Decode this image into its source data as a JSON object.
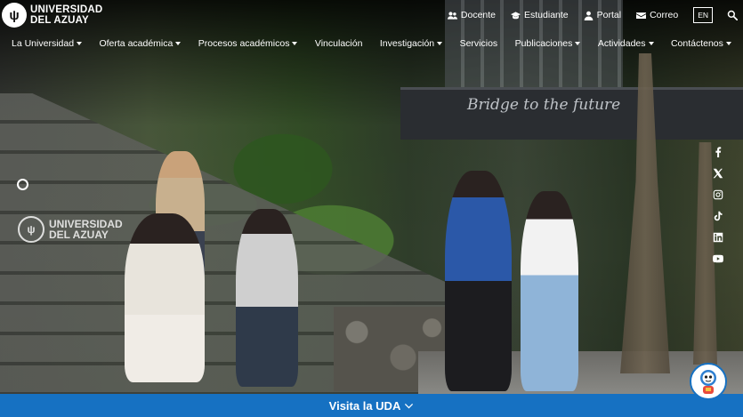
{
  "brand": {
    "line1": "UNIVERSIDAD",
    "line2": "DEL AZUAY"
  },
  "toplinks": [
    {
      "label": "Docente",
      "icon": "users-icon"
    },
    {
      "label": "Estudiante",
      "icon": "graduation-cap-icon"
    },
    {
      "label": "Portal",
      "icon": "user-icon"
    },
    {
      "label": "Correo",
      "icon": "envelope-icon"
    }
  ],
  "language": "EN",
  "nav": [
    {
      "label": "La Universidad",
      "dropdown": true
    },
    {
      "label": "Oferta académica",
      "dropdown": true
    },
    {
      "label": "Procesos académicos",
      "dropdown": true
    },
    {
      "label": "Vinculación",
      "dropdown": false
    },
    {
      "label": "Investigación",
      "dropdown": true
    },
    {
      "label": "Servicios",
      "dropdown": false
    },
    {
      "label": "Publicaciones",
      "dropdown": true
    },
    {
      "label": "Actividades",
      "dropdown": true
    },
    {
      "label": "Contáctenos",
      "dropdown": true
    }
  ],
  "hero": {
    "sign_text": "Bridge to the future",
    "watermark_line1": "UNIVERSIDAD",
    "watermark_line2": "DEL AZUAY"
  },
  "social": [
    "facebook-icon",
    "x-twitter-icon",
    "instagram-icon",
    "tiktok-icon",
    "linkedin-icon",
    "youtube-icon"
  ],
  "cta": {
    "label": "Visita la UDA"
  },
  "colors": {
    "accent": "#1671c2",
    "text": "#ffffff"
  }
}
